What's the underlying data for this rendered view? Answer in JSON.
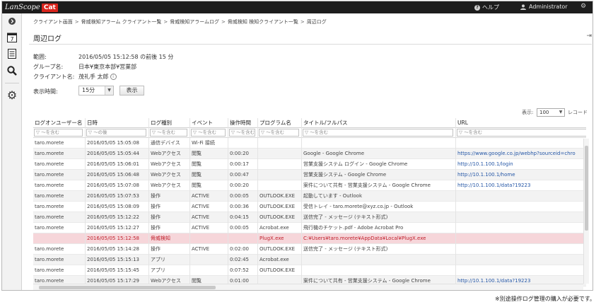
{
  "app": {
    "logo_text": "LanScope",
    "logo_badge": "Cat"
  },
  "topbar": {
    "help": "ヘルプ",
    "user": "Administrator"
  },
  "breadcrumb": [
    "クライアント画面",
    "脅威検知アラーム クライアント一覧",
    "脅威検知アラームログ",
    "脅威検知 検知クライアント一覧",
    "周辺ログ"
  ],
  "page_title": "周辺ログ",
  "info": {
    "range_label": "範囲:",
    "range_value": "2016/05/05 15:12:58 の前後 15 分",
    "group_label": "グループ名:",
    "group_value": "日本¥東京本部¥営業部",
    "client_label": "クライアント名:",
    "client_value": "茂礼手 太郎",
    "time_label": "表示時間:",
    "time_value": "15分",
    "show_button": "表示"
  },
  "display": {
    "label": "表示:",
    "value": "100",
    "unit": "レコード"
  },
  "table": {
    "columns": [
      "ログオンユーザー名",
      "日時",
      "ログ種別",
      "イベント",
      "操作時間",
      "プログラム名",
      "タイトル/フルパス",
      "URL"
    ],
    "filter_placeholder": "▽ ～を含む",
    "filter_placeholder_date": "▽ ～の後",
    "rows": [
      [
        "taro.morete",
        "2016/05/05 15:05:08",
        "通信デバイス",
        "Wi-Fi 接続",
        "",
        "",
        "",
        ""
      ],
      [
        "taro.morete",
        "2016/05/05 15:05:44",
        "Webアクセス",
        "閲覧",
        "0:00:20",
        "",
        "Google - Google Chrome",
        "https://www.google.co.jp/webhp?sourceid=chro"
      ],
      [
        "taro.morete",
        "2016/05/05 15:06:01",
        "Webアクセス",
        "閲覧",
        "0:00:17",
        "",
        "営業支援システム ログイン - Google Chrome",
        "http://10.1.100.1/login"
      ],
      [
        "taro.morete",
        "2016/05/05 15:06:48",
        "Webアクセス",
        "閲覧",
        "0:00:47",
        "",
        "営業支援システム - Google Chrome",
        "http://10.1.100.1/home"
      ],
      [
        "taro.morete",
        "2016/05/05 15:07:08",
        "Webアクセス",
        "閲覧",
        "0:00:20",
        "",
        "案件について共有 - 営業支援システム - Google Chrome",
        "http://10.1.100.1/data?19223"
      ],
      [
        "taro.morete",
        "2016/05/05 15:07:53",
        "操作",
        "ACTIVE",
        "0:00:05",
        "OUTLOOK.EXE",
        "起動しています - Outlook",
        ""
      ],
      [
        "taro.morete",
        "2016/05/05 15:08:09",
        "操作",
        "ACTIVE",
        "0:00:36",
        "OUTLOOK.EXE",
        "受信トレイ - taro.morete@xyz.co.jp - Outlook",
        ""
      ],
      [
        "taro.morete",
        "2016/05/05 15:12:22",
        "操作",
        "ACTIVE",
        "0:04:15",
        "OUTLOOK.EXE",
        "送信完了 - メッセージ (テキスト形式)",
        ""
      ],
      [
        "taro.morete",
        "2016/05/05 15:12:27",
        "操作",
        "ACTIVE",
        "0:00:05",
        "Acrobat.exe",
        "飛行機のチケット.pdf - Adobe Acrobat Pro",
        ""
      ],
      [
        "",
        "2016/05/05 15:12:58",
        "脅威検知",
        "",
        "",
        "PlugX.exe",
        "C:¥Users¥taro.morete¥AppData¥Local¥PlugX.exe",
        ""
      ],
      [
        "taro.morete",
        "2016/05/05 15:14:28",
        "操作",
        "ACTIVE",
        "0:02:00",
        "OUTLOOK.EXE",
        "送信完了 - メッセージ (テキスト形式)",
        ""
      ],
      [
        "taro.morete",
        "2016/05/05 15:15:13",
        "アプリ",
        "",
        "0:02:45",
        "Acrobat.exe",
        "",
        ""
      ],
      [
        "taro.morete",
        "2016/05/05 15:15:45",
        "アプリ",
        "",
        "0:07:52",
        "OUTLOOK.EXE",
        "",
        ""
      ],
      [
        "taro.morete",
        "2016/05/05 15:17:29",
        "Webアクセス",
        "閲覧",
        "0:01:00",
        "",
        "案件について共有 - 営業支援システム - Google Chrome",
        "http://10.1.100.1/data?19223"
      ]
    ]
  },
  "footnote": "※別途操作ログ管理の購入が必要です。"
}
